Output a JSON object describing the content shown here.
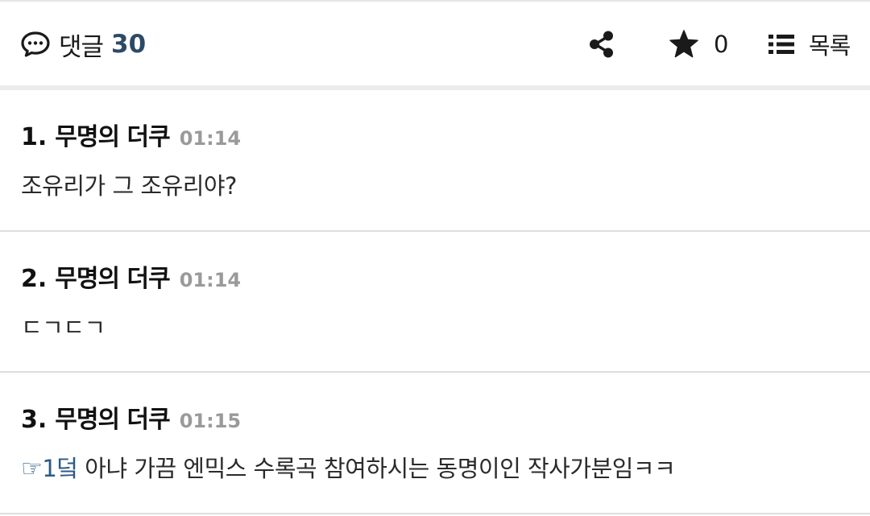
{
  "toolbar": {
    "comment_icon": "speech-bubble-icon",
    "comment_label": "댓글",
    "comment_count": "30",
    "share_icon": "share-icon",
    "star_icon": "star-icon",
    "star_count": "0",
    "list_icon": "list-icon",
    "list_label": "목록"
  },
  "comments": [
    {
      "number": "1.",
      "author": "무명의 더쿠",
      "time": "01:14",
      "body": "조유리가 그 조유리야?"
    },
    {
      "number": "2.",
      "author": "무명의 더쿠",
      "time": "01:14",
      "body": "ㄷㄱㄷㄱ"
    },
    {
      "number": "3.",
      "author": "무명의 더쿠",
      "time": "01:15",
      "reply_hand": "☞",
      "reply_ref": "1덬",
      "body": " 아냐 가끔 엔믹스 수록곡 참여하시는 동명이인 작사가분임ㅋㅋ"
    }
  ],
  "colors": {
    "accent": "#2c4a66",
    "link": "#2c5a86",
    "time": "#9a9a9a",
    "divider": "#dedede"
  }
}
